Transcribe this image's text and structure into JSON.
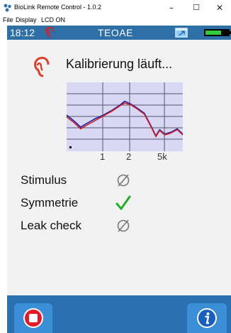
{
  "window": {
    "title": "BioLink Remote Control  -  1.0.2",
    "minimize_glyph": "–",
    "maximize_glyph": "☐",
    "close_glyph": "✕"
  },
  "menu": [
    "File",
    "Display",
    "LCD ON"
  ],
  "status": {
    "time": "18:12",
    "device": "TEOAE",
    "battery_level": 0.7,
    "colors": {
      "bar": "#2f6fa8",
      "battery": "#2fcb3a"
    }
  },
  "main": {
    "headline": "Kalibrierung läuft...",
    "checks": [
      {
        "label": "Stimulus",
        "state": "not-done",
        "icon": "empty-set-icon"
      },
      {
        "label": "Symmetrie",
        "state": "ok",
        "icon": "checkmark-icon"
      },
      {
        "label": "Leak check",
        "state": "not-done",
        "icon": "empty-set-icon"
      }
    ]
  },
  "chart_data": {
    "type": "line",
    "x_tick_labels": [
      "1",
      "2",
      "5k"
    ],
    "x_scale": "log",
    "xlim": [
      0.5,
      8
    ],
    "series": [
      {
        "color": "#1b1fa8",
        "x": [
          0.5,
          0.6,
          0.7,
          0.8,
          1.0,
          1.2,
          1.5,
          1.8,
          2.0,
          2.3,
          2.7,
          3.2,
          3.8,
          4.2,
          4.6,
          5.2,
          6.0,
          7.0,
          8.0
        ],
        "y": [
          62,
          55,
          48,
          52,
          58,
          62,
          68,
          74,
          78,
          75,
          70,
          64,
          48,
          38,
          45,
          40,
          42,
          46,
          40
        ]
      },
      {
        "color": "#d42020",
        "x": [
          0.5,
          0.6,
          0.7,
          0.8,
          1.0,
          1.2,
          1.5,
          1.8,
          2.0,
          2.3,
          2.7,
          3.2,
          3.8,
          4.2,
          4.6,
          5.2,
          6.0,
          7.0,
          8.0
        ],
        "y": [
          60,
          53,
          46,
          50,
          56,
          61,
          67,
          73,
          76,
          74,
          69,
          63,
          47,
          37,
          44,
          39,
          41,
          45,
          39
        ]
      }
    ],
    "ylim": [
      20,
      100
    ],
    "grid": true
  },
  "footer": {
    "colors": {
      "stop": "#e8182a",
      "info": "#1a5fc0"
    }
  }
}
